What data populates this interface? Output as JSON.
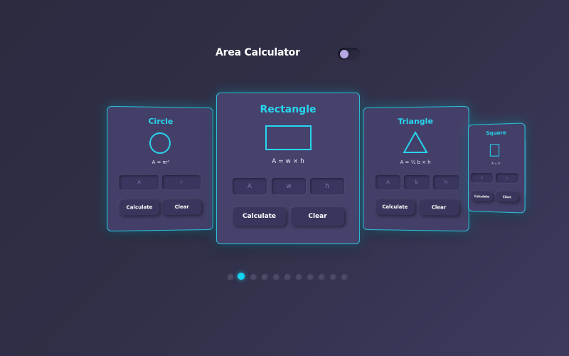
{
  "header": {
    "title": "Area Calculator",
    "theme_toggle_on": false
  },
  "cards": {
    "circle": {
      "title": "Circle",
      "formula": "A = πr²",
      "fields": [
        "A",
        "r"
      ],
      "calculate_label": "Calculate",
      "clear_label": "Clear"
    },
    "rectangle": {
      "title": "Rectangle",
      "formula": "A = w × h",
      "fields": [
        "A",
        "w",
        "h"
      ],
      "calculate_label": "Calculate",
      "clear_label": "Clear"
    },
    "triangle": {
      "title": "Triangle",
      "formula": "A = ½ b × h",
      "fields": [
        "A",
        "b",
        "h"
      ],
      "calculate_label": "Calculate",
      "clear_label": "Clear"
    },
    "square": {
      "title": "Square",
      "formula": "A = s²",
      "fields": [
        "A",
        "s"
      ],
      "calculate_label": "Calculate",
      "clear_label": "Clear"
    }
  },
  "pagination": {
    "count": 11,
    "active_index": 1
  },
  "colors": {
    "accent": "#27d6ee",
    "card_bg": "#443f68",
    "background": "#2c2b40"
  }
}
